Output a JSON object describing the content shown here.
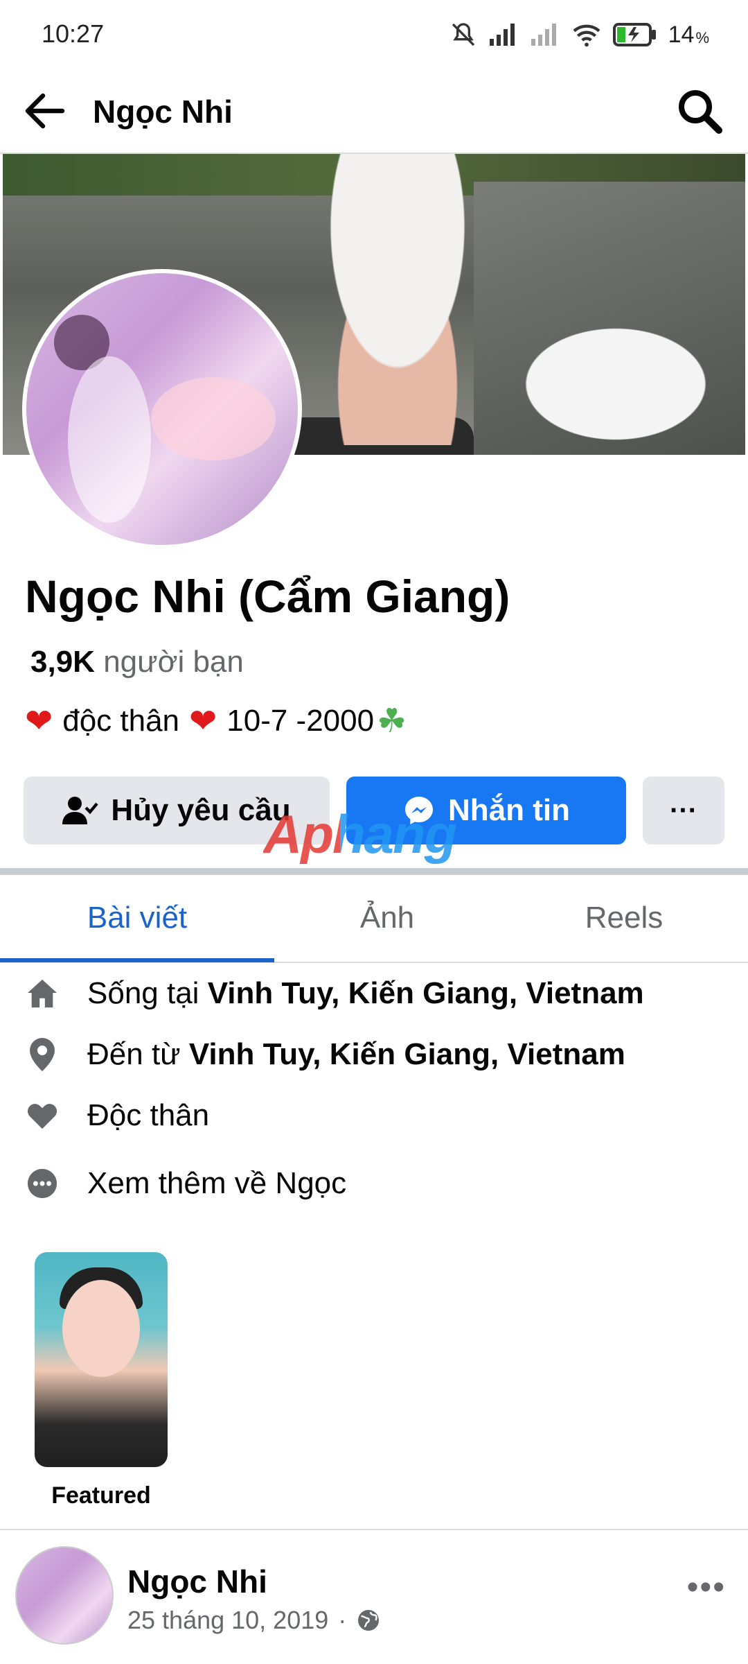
{
  "status_bar": {
    "time": "10:27",
    "battery": "14"
  },
  "header": {
    "title": "Ngọc Nhi"
  },
  "profile": {
    "name": "Ngọc Nhi (Cẩm Giang)",
    "friends_count": "3,9K",
    "friends_label": "người bạn",
    "bio": "độc thân",
    "bio_date": "10-7 -2000"
  },
  "actions": {
    "cancel_request": "Hủy yêu cầu",
    "message": "Nhắn tin",
    "more": "···"
  },
  "watermark": "Aphang",
  "tabs": [
    "Bài viết",
    "Ảnh",
    "Reels"
  ],
  "details": {
    "lives_prefix": "Sống tại",
    "lives_place": "Vinh Tuy, Kiến Giang, Vietnam",
    "from_prefix": "Đến từ",
    "from_place": "Vinh Tuy, Kiến Giang, Vietnam",
    "relationship": "Độc thân",
    "see_more": "Xem thêm về Ngọc"
  },
  "featured": {
    "label": "Featured"
  },
  "post": {
    "author": "Ngọc Nhi",
    "date": "25 tháng 10, 2019",
    "separator": "·",
    "more": "•••"
  },
  "colors": {
    "accent": "#1877f2",
    "tab_active": "#1b63c9",
    "heart": "#e0191a"
  }
}
